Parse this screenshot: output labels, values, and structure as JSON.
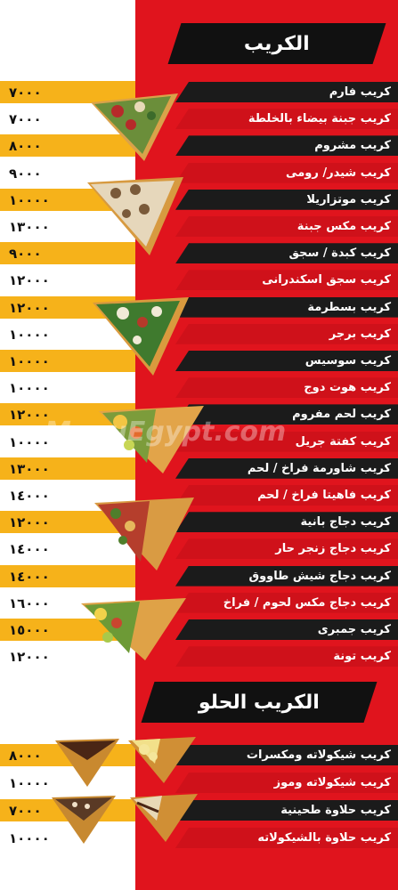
{
  "menu": {
    "section1_title": "الكريب",
    "section2_title": "الكريب الحلو",
    "savory_items": [
      {
        "name": "كريب فارم",
        "price": "٧٠٠٠"
      },
      {
        "name": "كريب جبنة بيضاء بالخلطة",
        "price": "٧٠٠٠"
      },
      {
        "name": "كريب مشروم",
        "price": "٨٠٠٠"
      },
      {
        "name": "كريب شيدر/ رومى",
        "price": "٩٠٠٠"
      },
      {
        "name": "كريب موتزاريلا",
        "price": "١٠٠٠٠"
      },
      {
        "name": "كريب مكس جبنة",
        "price": "١٣٠٠٠"
      },
      {
        "name": "كريب كبدة / سجق",
        "price": "٩٠٠٠"
      },
      {
        "name": "كريب سجق اسكندرانى",
        "price": "١٢٠٠٠"
      },
      {
        "name": "كريب بسطرمة",
        "price": "١٢٠٠٠"
      },
      {
        "name": "كريب برجر",
        "price": "١٠٠٠٠"
      },
      {
        "name": "كريب سوسيس",
        "price": "١٠٠٠٠"
      },
      {
        "name": "كريب هوت دوج",
        "price": "١٠٠٠٠"
      },
      {
        "name": "كريب لحم مفروم",
        "price": "١٢٠٠٠"
      },
      {
        "name": "كريب كفتة جريل",
        "price": "١٠٠٠٠"
      },
      {
        "name": "كريب شاورمة فراخ / لحم",
        "price": "١٣٠٠٠"
      },
      {
        "name": "كريب فاهيتا فراخ / لحم",
        "price": "١٤٠٠٠"
      },
      {
        "name": "كريب دجاج بانية",
        "price": "١٢٠٠٠"
      },
      {
        "name": "كريب دجاج زنجر حار",
        "price": "١٤٠٠٠"
      },
      {
        "name": "كريب دجاج شيش طاووق",
        "price": "١٤٠٠٠"
      },
      {
        "name": "كريب دجاج مكس لحوم / فراخ",
        "price": "١٦٠٠٠"
      },
      {
        "name": "كريب جمبرى",
        "price": "١٥٠٠٠"
      },
      {
        "name": "كريب تونة",
        "price": "١٢٠٠٠"
      }
    ],
    "sweet_items": [
      {
        "name": "كريب شيكولاته ومكسرات",
        "price": "٨٠٠٠"
      },
      {
        "name": "كريب شيكولاته وموز",
        "price": "١٠٠٠٠"
      },
      {
        "name": "كريب حلاوة طحينية",
        "price": "٧٠٠٠"
      },
      {
        "name": "كريب حلاوة بالشيكولاته",
        "price": "١٠٠٠٠"
      }
    ],
    "watermark": "MenuEgypt.com"
  },
  "colors": {
    "red": "#e0141d",
    "yellow": "#f6b21a",
    "black": "#111111"
  }
}
